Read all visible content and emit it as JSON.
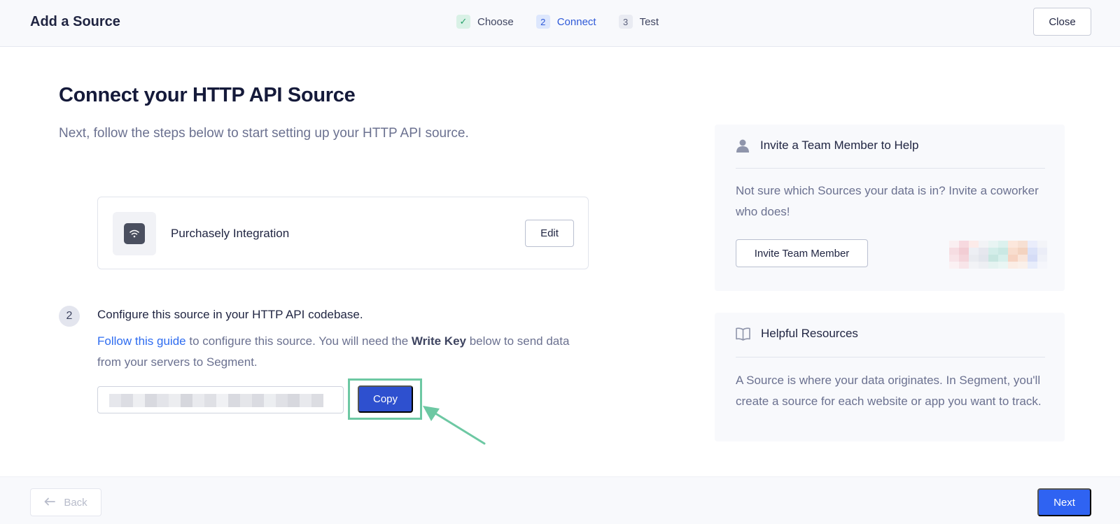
{
  "header": {
    "title": "Add a Source",
    "steps": [
      {
        "number": "✓",
        "label": "Choose",
        "state": "done"
      },
      {
        "number": "2",
        "label": "Connect",
        "state": "active"
      },
      {
        "number": "3",
        "label": "Test",
        "state": "pending"
      }
    ],
    "close_label": "Close"
  },
  "main": {
    "title": "Connect your HTTP API Source",
    "subtitle": "Next, follow the steps below to start setting up your HTTP API source.",
    "integration": {
      "name": "Purchasely Integration",
      "icon": "wifi-signal-icon",
      "edit_label": "Edit"
    },
    "configure": {
      "step_number": "2",
      "heading": "Configure this source in your HTTP API codebase.",
      "link_text": "Follow this guide",
      "desc_part1": " to configure this source. You will need the ",
      "desc_bold": "Write Key",
      "desc_part2": " below to send data from your servers to Segment.",
      "copy_label": "Copy"
    }
  },
  "sidebar": {
    "invite": {
      "title": "Invite a Team Member to Help",
      "icon": "person-icon",
      "text": "Not sure which Sources your data is in? Invite a coworker who does!",
      "button_label": "Invite Team Member"
    },
    "resources": {
      "title": "Helpful Resources",
      "icon": "book-icon",
      "text": "A Source is where your data originates. In Segment, you'll create a source for each website or app you want to track."
    }
  },
  "footer": {
    "back_label": "Back",
    "next_label": "Next"
  },
  "colors": {
    "primary": "#2f63f2",
    "copy_button": "#2e50cf",
    "highlight": "#6dc8a3",
    "link": "#2e6cf0"
  }
}
